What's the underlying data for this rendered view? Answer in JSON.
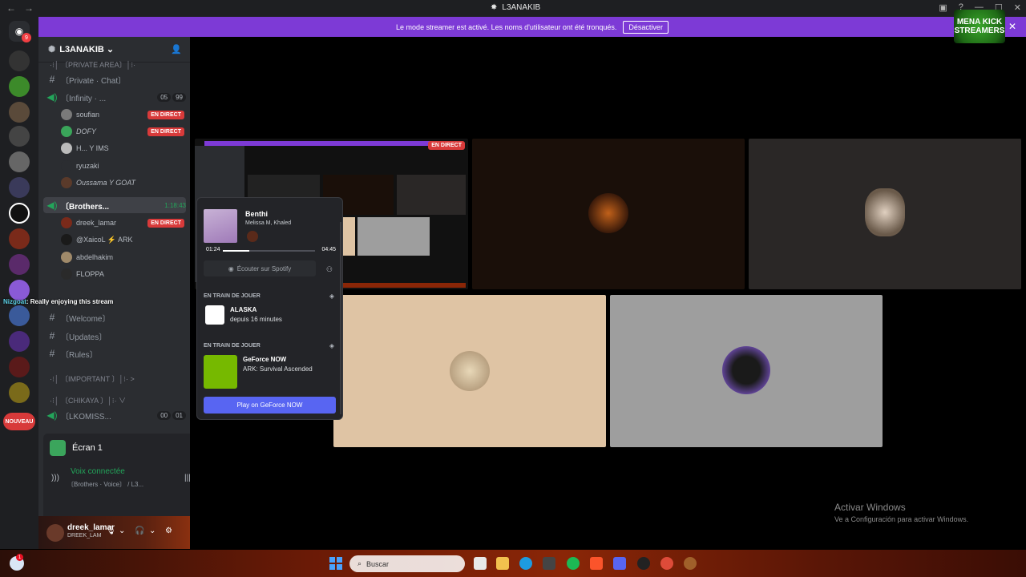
{
  "titlebar": {
    "title": "L3ANAKIB",
    "back": "←",
    "forward": "→"
  },
  "banner": {
    "text": "Le mode streamer est activé. Les noms d'utilisateur ont été tronqués.",
    "button": "Désactiver",
    "close": "✕"
  },
  "logo": {
    "line1": "MENA KICK",
    "line2": "STREAMERS"
  },
  "rail": {
    "dm_badge": "9",
    "new_label": "NOUVEAU"
  },
  "server": {
    "name": "L3ANAKIB"
  },
  "channels": [
    {
      "prefix": "—",
      "name": "·⁝│ 〔PRIVATE AREA〕│⁝·",
      "type": "category"
    },
    {
      "prefix": "#",
      "name": "〔Private · Chat〕",
      "type": "text"
    },
    {
      "prefix": "🔊",
      "name": "〔Infinity · ...",
      "type": "voice",
      "count_a": "05",
      "count_b": "99"
    }
  ],
  "infinity_users": [
    {
      "name": "soufian",
      "live": "EN DIRECT"
    },
    {
      "name": "DOFY",
      "live": "EN DIRECT"
    },
    {
      "name": "H... Y IMS",
      "live": ""
    },
    {
      "name": "ryuzaki",
      "live": ""
    },
    {
      "name": "Oussama Y GOAT",
      "live": ""
    }
  ],
  "brothers": {
    "name": "〔Brothers...",
    "time": "1:18:43"
  },
  "brothers_users": [
    {
      "name": "dreek_lamar",
      "live": "EN DIRECT"
    },
    {
      "name": "@XaicoL ⚡ ARK",
      "live": ""
    },
    {
      "name": "abdelhakim",
      "live": ""
    },
    {
      "name": "FLOPPA",
      "live": ""
    }
  ],
  "lower_channels": [
    {
      "prefix": "#",
      "name": "〔Welcome〕"
    },
    {
      "prefix": "#",
      "name": "〔Updates〕"
    },
    {
      "prefix": "#",
      "name": "〔Rules〕"
    }
  ],
  "categories2": [
    {
      "name": "·⁝│ 〔IMPORTANT 〕│⁝· >"
    },
    {
      "name": "·⁝│ 〔CHIKAYA 〕│⁝· ∨"
    }
  ],
  "lkomiss": {
    "name": "〔LKOMISS...",
    "count_a": "00",
    "count_b": "01"
  },
  "screen_panel": {
    "title": "Écran 1",
    "voice_status": "Voix connectée",
    "voice_channel": "〔Brothers · Voice〕 / L3..."
  },
  "userbar": {
    "name": "dreek_lamar",
    "sub": "DREEK_LAM"
  },
  "chat_overlay": {
    "nick": "Nizgoat",
    "text": ": Really enjoying this stream"
  },
  "stage": {
    "live_tag": "EN DIRECT"
  },
  "popout": {
    "track": "Benthi",
    "artist": "Melissa M, Khaled",
    "elapsed": "01:24",
    "duration": "04:45",
    "progress_fraction": 0.29,
    "spotify_button": "Écouter sur Spotify",
    "section1": "EN TRAIN DE JOUER",
    "game1": "ALASKA",
    "game1_detail": "depuis 16 minutes",
    "section2": "EN TRAIN DE JOUER",
    "game2": "GeForce NOW",
    "game2_detail": "ARK: Survival Ascended",
    "play_button": "Play on GeForce NOW"
  },
  "activate": {
    "line1": "Activar Windows",
    "line2": "Ve a Configuración para activar Windows."
  },
  "taskbar": {
    "search_placeholder": "Buscar",
    "notif_badge": "1"
  }
}
